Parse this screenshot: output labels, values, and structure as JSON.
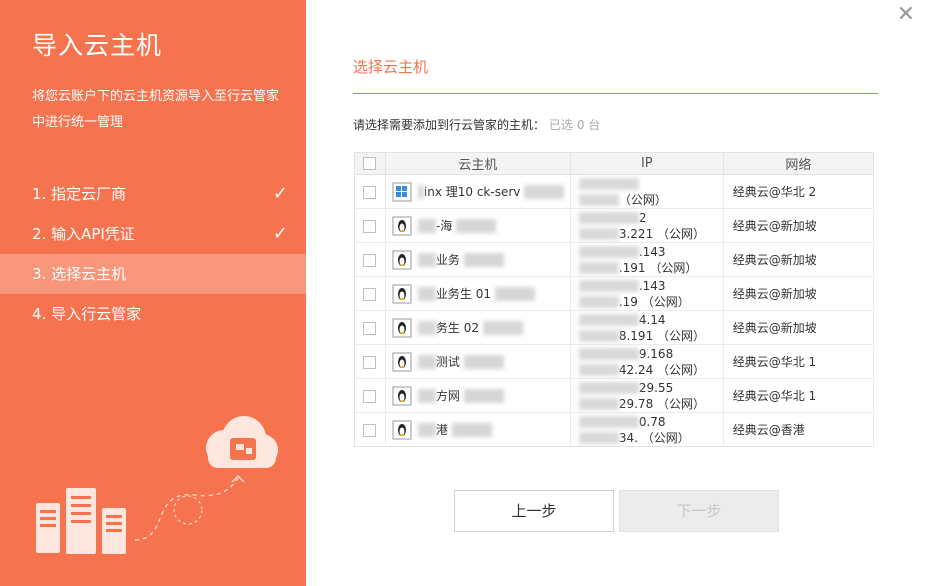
{
  "sidebar": {
    "title": "导入云主机",
    "desc": "将您云账户下的云主机资源导入至行云管家中进行统一管理",
    "steps": [
      {
        "label": "1. 指定云厂商",
        "done": true
      },
      {
        "label": "2. 输入API凭证",
        "done": true
      },
      {
        "label": "3. 选择云主机",
        "active": true
      },
      {
        "label": "4. 导入行云管家"
      }
    ],
    "check_glyph": "✓"
  },
  "close_glyph": "✕",
  "main": {
    "section_title": "选择云主机",
    "hint": "请选择需要添加到行云管家的主机：",
    "selected_count": "已选 0 台",
    "table": {
      "headers": [
        "云主机",
        "IP",
        "网络"
      ],
      "rows": [
        {
          "name": "inx 理10 ck-serv",
          "os": "windows",
          "ip1": "",
          "ip2": "（公网）",
          "network": "经典云@华北 2"
        },
        {
          "name": "-海",
          "os": "linux",
          "ip1": "2",
          "ip2": "3.221 （公网）",
          "network": "经典云@新加坡"
        },
        {
          "name": "业务",
          "os": "linux",
          "ip1": ".143",
          "ip2": ".191 （公网）",
          "network": "经典云@新加坡"
        },
        {
          "name": "业务生 01",
          "os": "linux",
          "ip1": ".143",
          "ip2": ".19 （公网）",
          "network": "经典云@新加坡"
        },
        {
          "name": "务生 02",
          "os": "linux",
          "ip1": "4.14",
          "ip2": "8.191 （公网）",
          "network": "经典云@新加坡"
        },
        {
          "name": "测试",
          "os": "linux",
          "ip1": "9.168",
          "ip2": "42.24 （公网）",
          "network": "经典云@华北 1"
        },
        {
          "name": "方网",
          "os": "linux",
          "ip1": "29.55",
          "ip2": "29.78 （公网）",
          "network": "经典云@华北 1"
        },
        {
          "name": "港",
          "os": "linux",
          "ip1": "0.78",
          "ip2": "34. （公网）",
          "network": "经典云@香港"
        }
      ]
    }
  },
  "buttons": {
    "prev": "上一步",
    "next": "下一步"
  }
}
